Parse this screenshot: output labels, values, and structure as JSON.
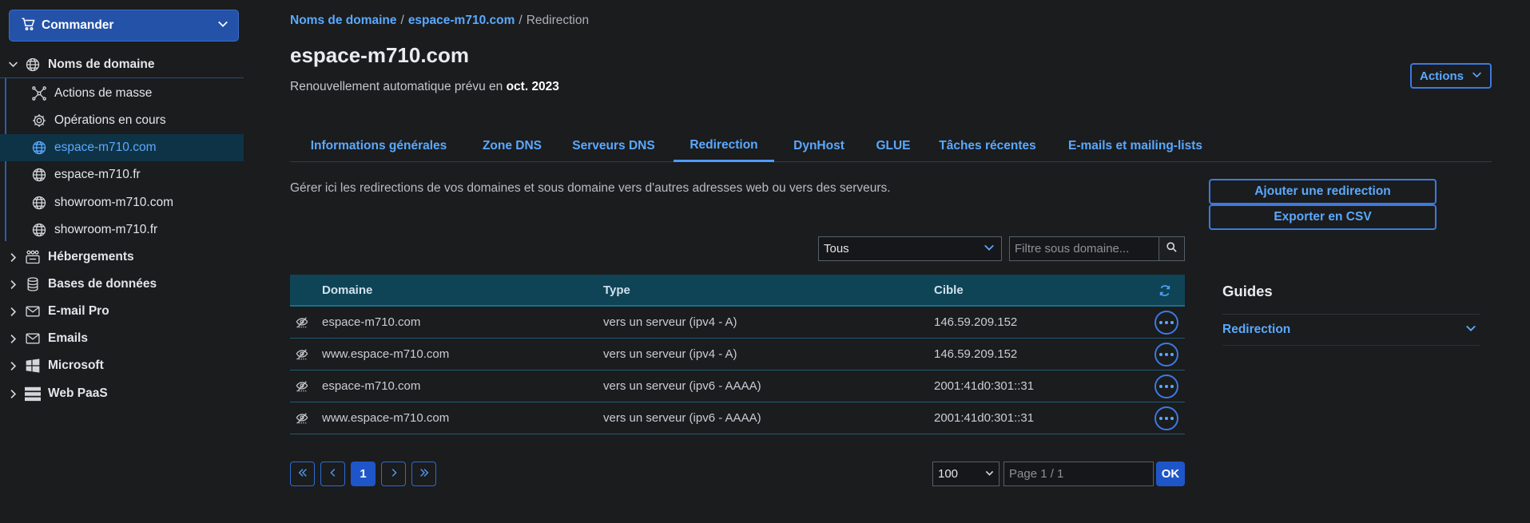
{
  "sidebar": {
    "order_label": "Commander",
    "sections": [
      {
        "label": "Noms de domaine",
        "icon": "globe-icon",
        "expanded": true
      },
      {
        "label": "Hébergements",
        "icon": "hosting-icon",
        "expanded": false
      },
      {
        "label": "Bases de données",
        "icon": "database-icon",
        "expanded": false
      },
      {
        "label": "E-mail Pro",
        "icon": "mail-icon",
        "expanded": false
      },
      {
        "label": "Emails",
        "icon": "mail-icon",
        "expanded": false
      },
      {
        "label": "Microsoft",
        "icon": "windows-icon",
        "expanded": false
      },
      {
        "label": "Web PaaS",
        "icon": "server-icon",
        "expanded": false
      }
    ],
    "domain_items": [
      {
        "label": "Actions de masse",
        "icon": "bulk-actions-icon",
        "active": false
      },
      {
        "label": "Opérations en cours",
        "icon": "gear-icon",
        "active": false
      },
      {
        "label": "espace-m710.com",
        "icon": "globe-icon",
        "active": true
      },
      {
        "label": "espace-m710.fr",
        "icon": "globe-icon",
        "active": false
      },
      {
        "label": "showroom-m710.com",
        "icon": "globe-icon",
        "active": false
      },
      {
        "label": "showroom-m710.fr",
        "icon": "globe-icon",
        "active": false
      }
    ]
  },
  "breadcrumb": {
    "items": [
      "Noms de domaine",
      "espace-m710.com"
    ],
    "separator": "/",
    "current": "Redirection"
  },
  "header": {
    "title": "espace-m710.com",
    "renewal_text": "Renouvellement automatique prévu en",
    "renewal_date": "oct. 2023",
    "actions_label": "Actions"
  },
  "tabs": [
    {
      "label": "Informations générales",
      "active": false
    },
    {
      "label": "Zone DNS",
      "active": false
    },
    {
      "label": "Serveurs DNS",
      "active": false
    },
    {
      "label": "Redirection",
      "active": true
    },
    {
      "label": "DynHost",
      "active": false
    },
    {
      "label": "GLUE",
      "active": false
    },
    {
      "label": "Tâches récentes",
      "active": false
    },
    {
      "label": "E-mails et mailing-lists",
      "active": false
    }
  ],
  "main": {
    "description": "Gérer ici les redirections de vos domaines et sous domaine vers d'autres adresses web ou vers des serveurs.",
    "add_button": "Ajouter une redirection",
    "export_button": "Exporter en CSV",
    "filter_select": "Tous",
    "filter_placeholder": "Filtre sous domaine..."
  },
  "table": {
    "headers": {
      "domain": "Domaine",
      "type": "Type",
      "target": "Cible"
    },
    "rows": [
      {
        "domain": "espace-m710.com",
        "type": "vers un serveur (ipv4 - A)",
        "target": "146.59.209.152"
      },
      {
        "domain": "www.espace-m710.com",
        "type": "vers un serveur (ipv4 - A)",
        "target": "146.59.209.152"
      },
      {
        "domain": "espace-m710.com",
        "type": "vers un serveur (ipv6 - AAAA)",
        "target": "2001:41d0:301::31"
      },
      {
        "domain": "www.espace-m710.com",
        "type": "vers un serveur (ipv6 - AAAA)",
        "target": "2001:41d0:301::31"
      }
    ]
  },
  "pagination": {
    "current_page": "1",
    "per_page": "100",
    "page_placeholder": "Page 1 / 1",
    "ok_label": "OK"
  },
  "guides": {
    "title": "Guides",
    "item": "Redirection"
  },
  "colors": {
    "accent": "#4e9cf5",
    "background": "#1b1c1e",
    "table_header": "#0f4456",
    "primary_button": "#1e56c9"
  }
}
